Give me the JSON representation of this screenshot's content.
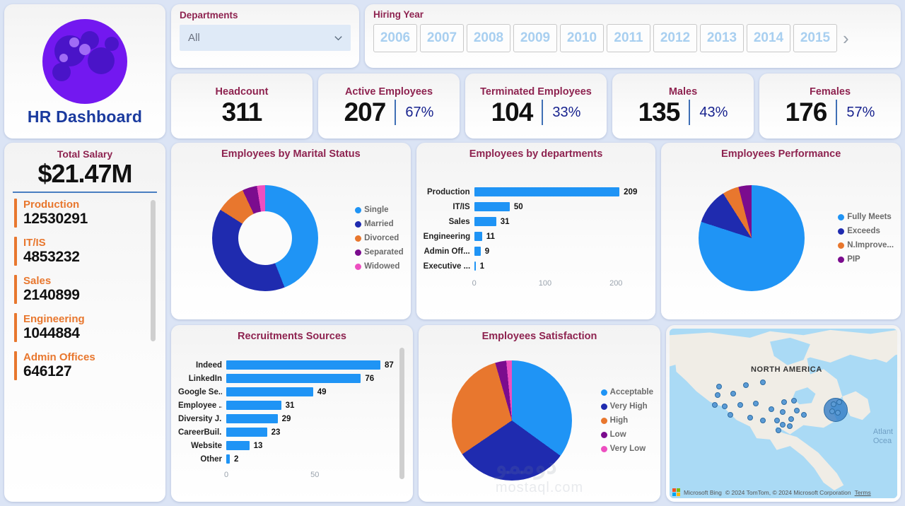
{
  "brand": {
    "title": "HR Dashboard",
    "logo_icon": "bubble-circle-logo",
    "logo_color": "#7318f0"
  },
  "filters": {
    "departments": {
      "label": "Departments",
      "value": "All",
      "chevron_icon": "chevron-down-icon"
    },
    "hiring_year": {
      "label": "Hiring Year",
      "years": [
        "2006",
        "2007",
        "2008",
        "2009",
        "2010",
        "2011",
        "2012",
        "2013",
        "2014",
        "2015"
      ],
      "next_icon": "chevron-right-icon"
    }
  },
  "kpis": [
    {
      "label": "Headcount",
      "value": "311",
      "pct": ""
    },
    {
      "label": "Active Employees",
      "value": "207",
      "pct": "67%"
    },
    {
      "label": "Terminated Employees",
      "value": "104",
      "pct": "33%"
    },
    {
      "label": "Males",
      "value": "135",
      "pct": "43%"
    },
    {
      "label": "Females",
      "value": "176",
      "pct": "57%"
    }
  ],
  "salary_panel": {
    "label": "Total Salary",
    "total": "$21.47M",
    "items": [
      {
        "dept": "Production",
        "amount": "12530291"
      },
      {
        "dept": "IT/IS",
        "amount": "4853232"
      },
      {
        "dept": "Sales",
        "amount": "2140899"
      },
      {
        "dept": "Engineering",
        "amount": "1044884"
      },
      {
        "dept": "Admin Offices",
        "amount": "646127"
      }
    ]
  },
  "map": {
    "region_label": "NORTH AMERICA",
    "ocean_label_line1": "Atlant",
    "ocean_label_line2": "Ocea",
    "provider": "Microsoft Bing",
    "attribution": "© 2024 TomTom, © 2024 Microsoft Corporation",
    "terms": "Terms"
  },
  "watermark": {
    "text": "دوممو",
    "sub": "mostaql.com"
  },
  "chart_data": [
    {
      "type": "pie",
      "title": "Employees by Marital Status",
      "donut": true,
      "categories": [
        "Single",
        "Married",
        "Divorced",
        "Separated",
        "Widowed"
      ],
      "values": [
        44,
        40,
        9,
        4.5,
        2.5
      ],
      "colors": [
        "#1f94f5",
        "#1f2baf",
        "#e8772e",
        "#7b0c8e",
        "#ed4fc0"
      ],
      "legend_position": "right"
    },
    {
      "type": "bar",
      "orientation": "horizontal",
      "title": "Employees by departments",
      "categories": [
        "Production",
        "IT/IS",
        "Sales",
        "Engineering",
        "Admin Off...",
        "Executive ..."
      ],
      "values": [
        209,
        50,
        31,
        11,
        9,
        1
      ],
      "xlim": [
        0,
        230
      ],
      "xticks": [
        "0",
        "100",
        "200"
      ],
      "bar_color": "#1f94f5"
    },
    {
      "type": "pie",
      "title": "Employees Performance",
      "donut": false,
      "categories": [
        "Fully Meets",
        "Exceeds",
        "N.Improve...",
        "PIP"
      ],
      "values": [
        80,
        11,
        5,
        4
      ],
      "colors": [
        "#1f94f5",
        "#1f2baf",
        "#e8772e",
        "#7b0c8e"
      ],
      "legend_position": "right"
    },
    {
      "type": "bar",
      "orientation": "horizontal",
      "title": "Recruitments Sources",
      "categories": [
        "Indeed",
        "LinkedIn",
        "Google Se...",
        "Employee ...",
        "Diversity J...",
        "CareerBuil...",
        "Website",
        "Other"
      ],
      "values": [
        87,
        76,
        49,
        31,
        29,
        23,
        13,
        2
      ],
      "xlim": [
        0,
        95
      ],
      "xticks": [
        "0",
        "50"
      ],
      "bar_color": "#1f94f5"
    },
    {
      "type": "pie",
      "title": "Employees Satisfaction",
      "donut": false,
      "categories": [
        "Acceptable",
        "Very High",
        "High",
        "Low",
        "Very Low"
      ],
      "values": [
        35,
        30.5,
        30,
        3,
        1.5
      ],
      "colors": [
        "#1f94f5",
        "#1f2baf",
        "#e8772e",
        "#7b0c8e",
        "#ed4fc0"
      ],
      "legend_position": "right"
    }
  ]
}
